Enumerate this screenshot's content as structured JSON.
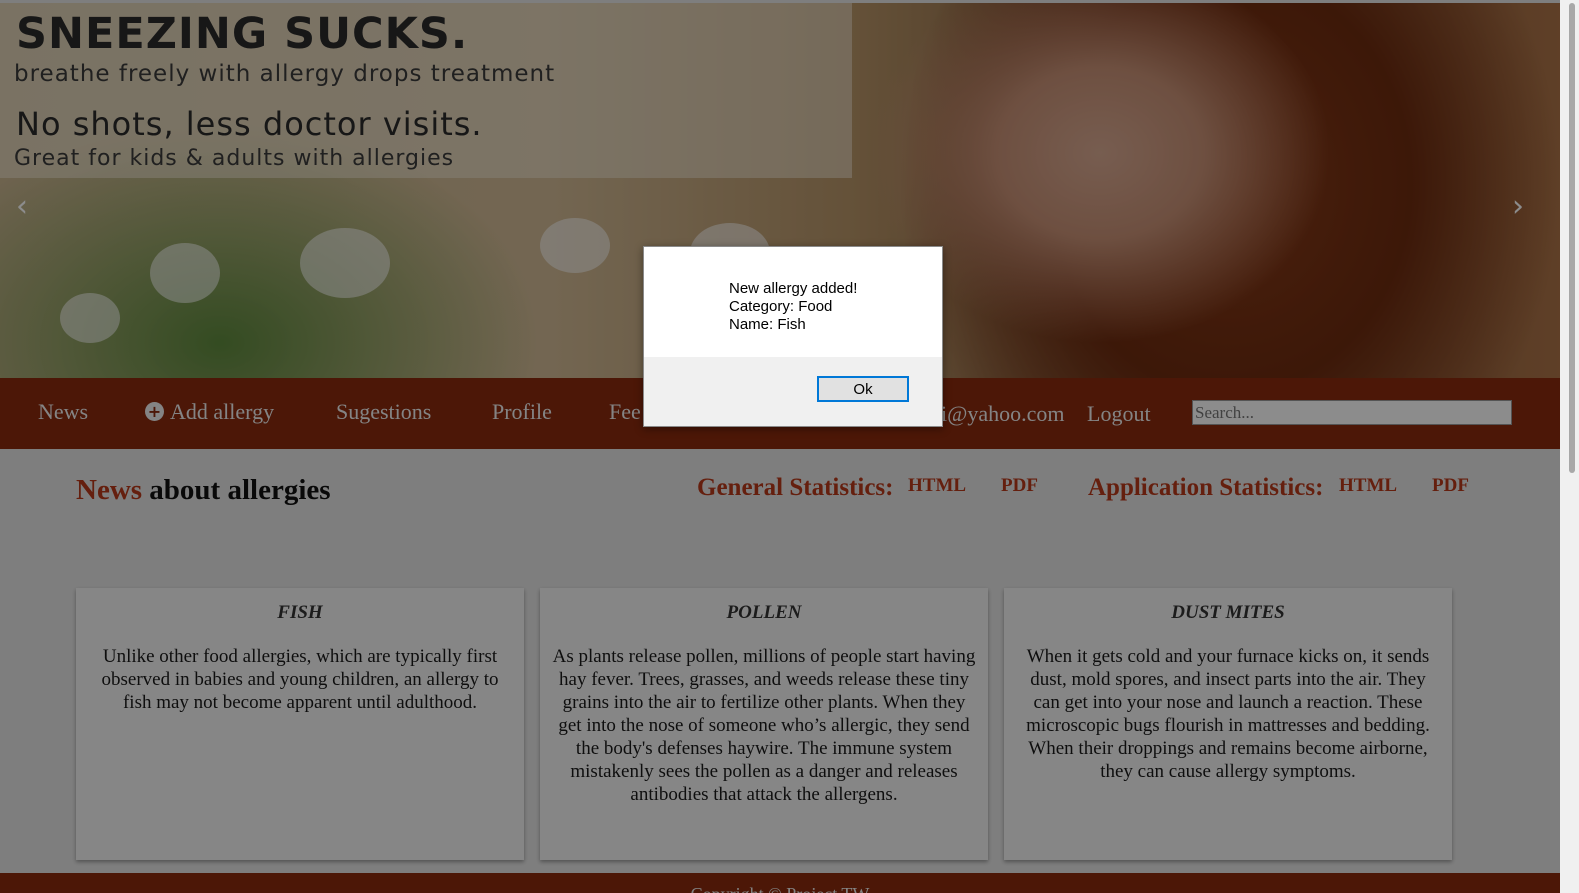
{
  "hero": {
    "headline": "SNEEZING SUCKS.",
    "subheadline": "breathe freely with allergy drops treatment",
    "headline2": "No shots, less doctor visits.",
    "subheadline2": "Great for kids & adults with allergies",
    "prev_arrow": "‹",
    "next_arrow": "›"
  },
  "nav": {
    "items": [
      "News",
      "Add allergy",
      "Sugestions",
      "Profile",
      "Fee"
    ],
    "add_icon": "+",
    "user_email": "di@yahoo.com",
    "logout": "Logout",
    "search_placeholder": "Search..."
  },
  "content": {
    "title_accent": "News",
    "title_rest": "about allergies",
    "general_label": "General Statistics:",
    "application_label": "Application Statistics:",
    "html_link": "HTML",
    "pdf_link": "PDF"
  },
  "cards": [
    {
      "title": "FISH",
      "text": "Unlike other food allergies, which are typically first observed in babies and young children, an allergy to fish may not become apparent until adulthood."
    },
    {
      "title": "POLLEN",
      "text": "As plants release pollen, millions of people start having hay fever. Trees, grasses, and weeds release these tiny grains into the air to fertilize other plants. When they get into the nose of someone who’s allergic, they send the body's defenses haywire. The immune system mistakenly sees the pollen as a danger and releases antibodies that attack the allergens."
    },
    {
      "title": "DUST MITES",
      "text": "When it gets cold and your furnace kicks on, it sends dust, mold spores, and insect parts into the air. They can get into your nose and launch a reaction. These microscopic bugs flourish in mattresses and bedding. When their droppings and remains become airborne, they can cause allergy symptoms."
    }
  ],
  "footer": {
    "text": "Copyright © Project TW"
  },
  "dialog": {
    "line1": "New allergy added!",
    "line2": "Category: Food",
    "line3": "Name: Fish",
    "ok": "Ok"
  },
  "colors": {
    "brand": "#8b2a0e",
    "accent": "#b93a1a",
    "dialog_focus": "#0078d7"
  }
}
